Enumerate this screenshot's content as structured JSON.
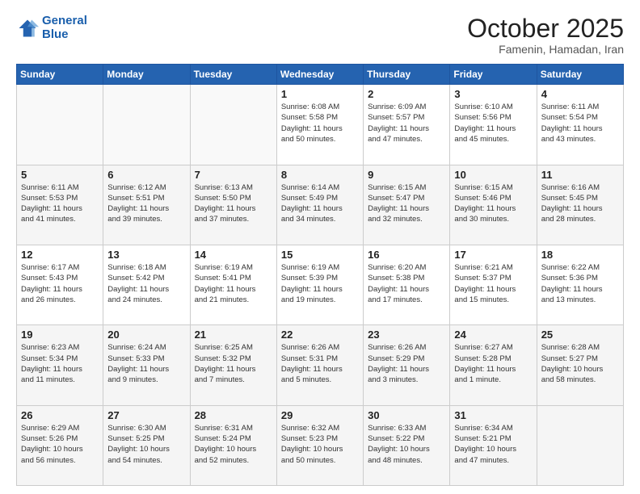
{
  "header": {
    "logo_line1": "General",
    "logo_line2": "Blue",
    "month": "October 2025",
    "location": "Famenin, Hamadan, Iran"
  },
  "weekdays": [
    "Sunday",
    "Monday",
    "Tuesday",
    "Wednesday",
    "Thursday",
    "Friday",
    "Saturday"
  ],
  "weeks": [
    [
      {
        "day": "",
        "info": ""
      },
      {
        "day": "",
        "info": ""
      },
      {
        "day": "",
        "info": ""
      },
      {
        "day": "1",
        "info": "Sunrise: 6:08 AM\nSunset: 5:58 PM\nDaylight: 11 hours\nand 50 minutes."
      },
      {
        "day": "2",
        "info": "Sunrise: 6:09 AM\nSunset: 5:57 PM\nDaylight: 11 hours\nand 47 minutes."
      },
      {
        "day": "3",
        "info": "Sunrise: 6:10 AM\nSunset: 5:56 PM\nDaylight: 11 hours\nand 45 minutes."
      },
      {
        "day": "4",
        "info": "Sunrise: 6:11 AM\nSunset: 5:54 PM\nDaylight: 11 hours\nand 43 minutes."
      }
    ],
    [
      {
        "day": "5",
        "info": "Sunrise: 6:11 AM\nSunset: 5:53 PM\nDaylight: 11 hours\nand 41 minutes."
      },
      {
        "day": "6",
        "info": "Sunrise: 6:12 AM\nSunset: 5:51 PM\nDaylight: 11 hours\nand 39 minutes."
      },
      {
        "day": "7",
        "info": "Sunrise: 6:13 AM\nSunset: 5:50 PM\nDaylight: 11 hours\nand 37 minutes."
      },
      {
        "day": "8",
        "info": "Sunrise: 6:14 AM\nSunset: 5:49 PM\nDaylight: 11 hours\nand 34 minutes."
      },
      {
        "day": "9",
        "info": "Sunrise: 6:15 AM\nSunset: 5:47 PM\nDaylight: 11 hours\nand 32 minutes."
      },
      {
        "day": "10",
        "info": "Sunrise: 6:15 AM\nSunset: 5:46 PM\nDaylight: 11 hours\nand 30 minutes."
      },
      {
        "day": "11",
        "info": "Sunrise: 6:16 AM\nSunset: 5:45 PM\nDaylight: 11 hours\nand 28 minutes."
      }
    ],
    [
      {
        "day": "12",
        "info": "Sunrise: 6:17 AM\nSunset: 5:43 PM\nDaylight: 11 hours\nand 26 minutes."
      },
      {
        "day": "13",
        "info": "Sunrise: 6:18 AM\nSunset: 5:42 PM\nDaylight: 11 hours\nand 24 minutes."
      },
      {
        "day": "14",
        "info": "Sunrise: 6:19 AM\nSunset: 5:41 PM\nDaylight: 11 hours\nand 21 minutes."
      },
      {
        "day": "15",
        "info": "Sunrise: 6:19 AM\nSunset: 5:39 PM\nDaylight: 11 hours\nand 19 minutes."
      },
      {
        "day": "16",
        "info": "Sunrise: 6:20 AM\nSunset: 5:38 PM\nDaylight: 11 hours\nand 17 minutes."
      },
      {
        "day": "17",
        "info": "Sunrise: 6:21 AM\nSunset: 5:37 PM\nDaylight: 11 hours\nand 15 minutes."
      },
      {
        "day": "18",
        "info": "Sunrise: 6:22 AM\nSunset: 5:36 PM\nDaylight: 11 hours\nand 13 minutes."
      }
    ],
    [
      {
        "day": "19",
        "info": "Sunrise: 6:23 AM\nSunset: 5:34 PM\nDaylight: 11 hours\nand 11 minutes."
      },
      {
        "day": "20",
        "info": "Sunrise: 6:24 AM\nSunset: 5:33 PM\nDaylight: 11 hours\nand 9 minutes."
      },
      {
        "day": "21",
        "info": "Sunrise: 6:25 AM\nSunset: 5:32 PM\nDaylight: 11 hours\nand 7 minutes."
      },
      {
        "day": "22",
        "info": "Sunrise: 6:26 AM\nSunset: 5:31 PM\nDaylight: 11 hours\nand 5 minutes."
      },
      {
        "day": "23",
        "info": "Sunrise: 6:26 AM\nSunset: 5:29 PM\nDaylight: 11 hours\nand 3 minutes."
      },
      {
        "day": "24",
        "info": "Sunrise: 6:27 AM\nSunset: 5:28 PM\nDaylight: 11 hours\nand 1 minute."
      },
      {
        "day": "25",
        "info": "Sunrise: 6:28 AM\nSunset: 5:27 PM\nDaylight: 10 hours\nand 58 minutes."
      }
    ],
    [
      {
        "day": "26",
        "info": "Sunrise: 6:29 AM\nSunset: 5:26 PM\nDaylight: 10 hours\nand 56 minutes."
      },
      {
        "day": "27",
        "info": "Sunrise: 6:30 AM\nSunset: 5:25 PM\nDaylight: 10 hours\nand 54 minutes."
      },
      {
        "day": "28",
        "info": "Sunrise: 6:31 AM\nSunset: 5:24 PM\nDaylight: 10 hours\nand 52 minutes."
      },
      {
        "day": "29",
        "info": "Sunrise: 6:32 AM\nSunset: 5:23 PM\nDaylight: 10 hours\nand 50 minutes."
      },
      {
        "day": "30",
        "info": "Sunrise: 6:33 AM\nSunset: 5:22 PM\nDaylight: 10 hours\nand 48 minutes."
      },
      {
        "day": "31",
        "info": "Sunrise: 6:34 AM\nSunset: 5:21 PM\nDaylight: 10 hours\nand 47 minutes."
      },
      {
        "day": "",
        "info": ""
      }
    ]
  ]
}
